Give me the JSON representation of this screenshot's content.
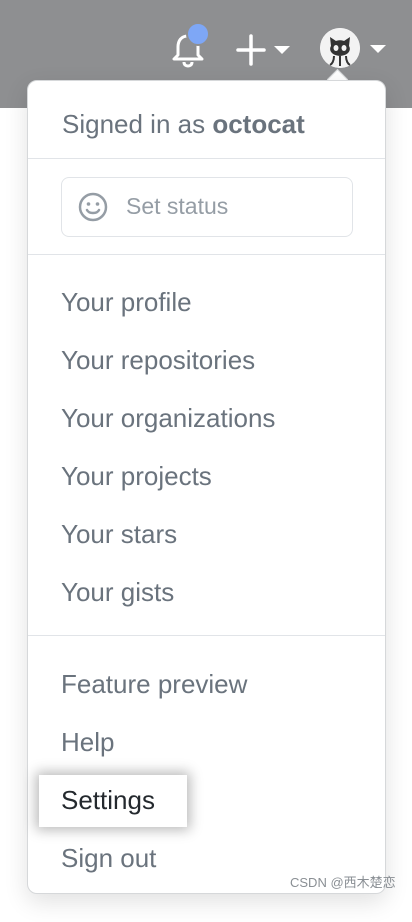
{
  "header": {
    "icons": [
      "bell-icon",
      "plus-icon",
      "chevron-down-icon",
      "avatar"
    ],
    "colors": {
      "background": "#8e8f91",
      "notification": "#7ea7f6"
    }
  },
  "dropdown": {
    "signed_in_prefix": "Signed in as",
    "username": "octocat",
    "status_label": "Set status",
    "profile_items": [
      "Your profile",
      "Your repositories",
      "Your organizations",
      "Your projects",
      "Your stars",
      "Your gists"
    ],
    "secondary_items": [
      "Feature preview",
      "Help",
      "Settings",
      "Sign out"
    ]
  },
  "watermark": "CSDN @西木楚恋"
}
